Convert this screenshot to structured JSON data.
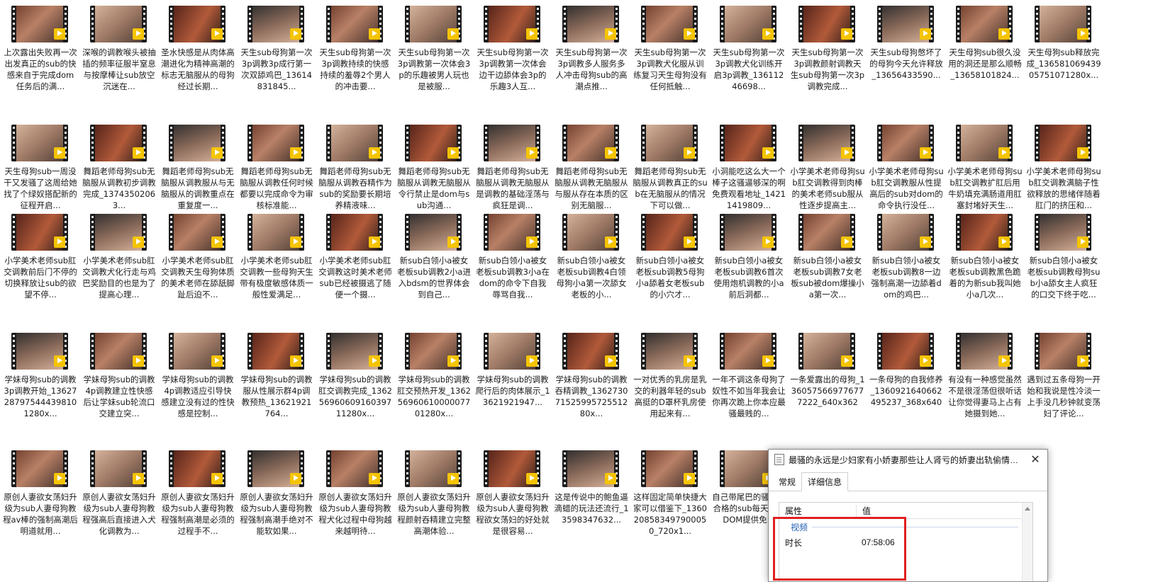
{
  "items": [
    {
      "caption": "上次露出失败再一次出发真正的sub的快感来自于完成dom任务后的满..."
    },
    {
      "caption": "深喉的调教喉头被抽插的频率征服半窒息与按摩棒让sub放空沉迷在..."
    },
    {
      "caption": "圣水快感是从肉体高潮进化为精神高潮的标志无脑服从的母狗经过长期..."
    },
    {
      "caption": "天生sub母狗第一次3p调教3p成行第一次双舔鸡巴_13614831845..."
    },
    {
      "caption": "天生sub母狗第一次3p调教持续的快感持续的羞辱2个男人的冲击要..."
    },
    {
      "caption": "天生sub母狗第一次3p调教第一次体会3p的乐趣被男人玩也是被服..."
    },
    {
      "caption": "天生sub母狗第一次3p调教第一次体会边干边舔体会3p的乐趣3人互..."
    },
    {
      "caption": "天生sub母狗第一次3p调教多人服务多人冲击母狗sub的高潮点推..."
    },
    {
      "caption": "天生sub母狗第一次3p调教犬化服从训练复习天生母狗没有任何抵触..."
    },
    {
      "caption": "天生sub母狗第一次3p调教犬化训练开启3p调教_13611246698..."
    },
    {
      "caption": "天生sub母狗第一次3p调教颜射调教天生sub母狗第一次3p调教完成..."
    },
    {
      "caption": "天生sub母狗憋坏了的母狗今天允许释放_13656433590..."
    },
    {
      "caption": "天生母狗sub很久没用的洞还是那么顺畅_13658101824..."
    },
    {
      "caption": "天生母狗sub释放完成_13658106943905751071280x..."
    },
    {
      "caption": "天生母狗sub一周没干又发骚了这周给她找了个绿奴搭配新的征程开启..."
    },
    {
      "caption": "舞蹈老师母狗sub无脑服从调教初步调教完成_13743502063..."
    },
    {
      "caption": "舞蹈老师母狗sub无脑服从调教服从与无脑服从的调教重点在重复度一..."
    },
    {
      "caption": "舞蹈老师母狗sub无脑服从调教任何时候都要以完成命令为审核标准能..."
    },
    {
      "caption": "舞蹈老师母狗sub无脑服从调教吞精作为sub的奖励要长期培养精液味..."
    },
    {
      "caption": "舞蹈老师母狗sub无脑服从调教无脑服从令行禁止是dom与sub沟通..."
    },
    {
      "caption": "舞蹈老师母狗sub无脑服从调教无脑服从是调教的基础淫荡与疯狂是调..."
    },
    {
      "caption": "舞蹈老师母狗sub无脑服从调教无脑服从与服从存在本质的区别无脑服..."
    },
    {
      "caption": "舞蹈老师母狗sub无脑服从调教真正的sub在无脑服从的情况下可以做..."
    },
    {
      "caption": "小洞能吃这么大一个棒子这骚逼够深的啊免费观看地址_14211419809..."
    },
    {
      "caption": "小学美术老师母狗sub肛交调教得到肉棒的美术老师sub服从性逐步提高主..."
    },
    {
      "caption": "小学美术老师母狗sub肛交调教服从性提高后的sub对dom的命令执行没任..."
    },
    {
      "caption": "小学美术老师母狗sub肛交调教扩肛后用牛奶填充满肠道用肛塞封堵好天生..."
    },
    {
      "caption": "小学美术老师母狗sub肛交调教满脑子性欲释放的思绪伴随着肛门的挤压和..."
    },
    {
      "caption": "小学美术老师sub肛交调教前后门不停的切换释放让sub的欲望不停..."
    },
    {
      "caption": "小学美术老师sub肛交调教犬化行走与鸡巴奖励目的也是为了提高心理..."
    },
    {
      "caption": "小学美术老师sub肛交调教天生母狗体质的美术老师在舔舐脚趾后迫不..."
    },
    {
      "caption": "小学美术老师sub肛交调教一些母狗天生带有极度敏感体质一般性爱满足..."
    },
    {
      "caption": "小学美术老师sub肛交调教这时美术老师sub已经被摄逃了随便一个摄..."
    },
    {
      "caption": "新sub白领小a被女老板sub调教2小a进入bdsm的世界体会到自己..."
    },
    {
      "caption": "新sub白领小a被女老板sub调教3小a在dom的命令下自我辱骂自我..."
    },
    {
      "caption": "新sub白领小a被女老板sub调教4白领母狗小a第一次舔女老板的小..."
    },
    {
      "caption": "新sub白领小a被女老板sub调教5母狗小a舔着女老板sub的小穴才..."
    },
    {
      "caption": "新sub白领小a被女老板sub调教6首次使用炮机调教的小a前后洞都..."
    },
    {
      "caption": "新sub白领小a被女老板sub调教7女老板sub被dom爆操小a第一次..."
    },
    {
      "caption": "新sub白领小a被女老板sub调教8一边强制高潮一边舔着dom的鸡巴..."
    },
    {
      "caption": "新sub白领小a被女老板sub调教黑色跪着的为新sub我叫她小a几次..."
    },
    {
      "caption": "新sub白领小a被女老板sub调教母狗sub小a舔女主人疯狂的口交下终于吃..."
    },
    {
      "caption": "学妹母狗sub的调教3p调教开始_13627287975444398101280x..."
    },
    {
      "caption": "学妹母狗sub的调教4p调教建立性快感后让学妹sub轮流口交建立突..."
    },
    {
      "caption": "学妹母狗sub的调教4p调教适应引导快感建立没有过的性快感是控制..."
    },
    {
      "caption": "学妹母狗sub的调教服从性展示群4p调教预热_13621921764..."
    },
    {
      "caption": "学妹母狗sub的调教肛交调教完成_13625696060916039711280x..."
    },
    {
      "caption": "学妹母狗sub的调教肛交预热开发_13625696061000007701280x..."
    },
    {
      "caption": "学妹母狗sub的调教爬行后的肉体展示_13621921947..."
    },
    {
      "caption": "学妹母狗sub的调教吞精调教_13627307152599572551280x..."
    },
    {
      "caption": "一对优秀的乳房是乳交的利器年轻的sub高挺的D罩杯乳房使用起来有..."
    },
    {
      "caption": "一年不调这条母狗了奴性不如当年我会让你再次跪上你本应最骚最贱的..."
    },
    {
      "caption": "一条爱露出的母狗_1360575669776777222_640x362"
    },
    {
      "caption": "一条母狗的自我修养_1360921640662495237_368x640"
    },
    {
      "caption": "有没有一种感觉虽然不是很淫荡但很听话让你觉得妻马上占有她摄到她..."
    },
    {
      "caption": "遇到过五条母狗一开始和我说是性冷淡一上手没几秒钟就变荡妇了评论..."
    },
    {
      "caption": "原创人妻欲女荡妇升级为sub人妻母狗教程av棒的强制高潮后明道就用..."
    },
    {
      "caption": "原创人妻欲女荡妇升级为sub人妻母狗教程强高后直接进入犬化调教为..."
    },
    {
      "caption": "原创人妻欲女荡妇升级为sub人妻母狗教程强制高潮是必须的过程手不..."
    },
    {
      "caption": "原创人妻欲女荡妇升级为sub人妻母狗教程强制高潮手绝对不能软如果..."
    },
    {
      "caption": "原创人妻欲女荡妇升级为sub人妻母狗教程犬化过程中母狗越来越明待..."
    },
    {
      "caption": "原创人妻欲女荡妇升级为sub人妻母狗教程颜射吞精建立完整高潮体验..."
    },
    {
      "caption": "原创人妻欲女荡妇升级为sub人妻母狗教程欲女荡妇的好处就是很容易..."
    },
    {
      "caption": "这是传说中的鲍鱼逼滴蜡的玩法还流行_13598347632..."
    },
    {
      "caption": "这样固定简单快捷大家可以借鉴下_1360208583497900050_720x1..."
    },
    {
      "caption": "自己带尾巴的骚逼逼合格的sub每天都有DOM提供免..."
    }
  ],
  "dialog": {
    "title": "最骚的永远是少妇家有小娇妻那些让人肾亏的娇妻出轨偷情边做爱...",
    "close_icon": "close-icon",
    "tabs": [
      "常规",
      "详细信息"
    ],
    "active_tab": "详细信息",
    "col_property": "属性",
    "col_value": "值",
    "section": "视频",
    "rows": [
      {
        "key": "时长",
        "value": "07:58:06"
      }
    ]
  },
  "colors": {
    "accent_highlight": "#e02020",
    "play_badge": "#f5c400",
    "section_blue": "#1e5fb4"
  }
}
